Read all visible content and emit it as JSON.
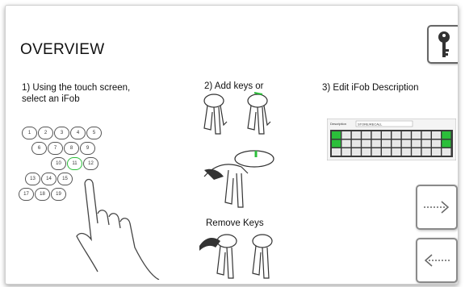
{
  "title": "OVERVIEW",
  "steps": {
    "step1": "1) Using the touch screen, select an iFob",
    "step2": "2) Add keys or",
    "step3": "3) Edit iFob Description",
    "remove": "Remove Keys"
  },
  "keypad": {
    "rows": [
      [
        "1",
        "2",
        "3",
        "4",
        "5"
      ],
      [
        "6",
        "7",
        "8",
        "9"
      ],
      [
        "10",
        "11",
        "12"
      ],
      [
        "13",
        "14",
        "15"
      ],
      [
        "17",
        "18",
        "19"
      ]
    ],
    "selected": "11"
  },
  "description_panel": {
    "label": "Description",
    "value": "STORE/RECALL"
  },
  "icons": {
    "key": "key-icon",
    "next": "arrow-right-icon",
    "prev": "arrow-left-icon"
  },
  "colors": {
    "accent": "#2bbf3a"
  }
}
